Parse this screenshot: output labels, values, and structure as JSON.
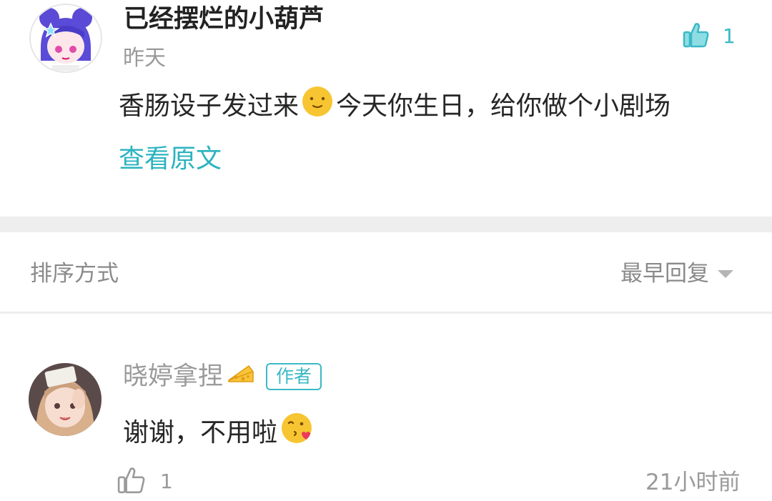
{
  "top_comment": {
    "username": "已经摆烂的小葫芦",
    "time": "昨天",
    "content_before_emoji": "香肠设子发过来",
    "content_after_emoji": "今天你生日，给你做个小剧场",
    "view_original": "查看原文",
    "like_count": "1"
  },
  "sort": {
    "label": "排序方式",
    "value": "最早回复"
  },
  "reply": {
    "username": "晓婷拿捏",
    "badge": "作者",
    "content": "谢谢，不用啦",
    "like_count": "1",
    "time": "21小时前"
  },
  "colors": {
    "accent": "#2bb3c0",
    "text_primary": "#262626",
    "text_secondary": "#9a9a9a",
    "divider": "#eeeeee"
  },
  "icons": [
    "thumbs-up-icon",
    "smile-emoji-icon",
    "cheese-icon",
    "kiss-emoji-icon",
    "caret-down-icon"
  ]
}
